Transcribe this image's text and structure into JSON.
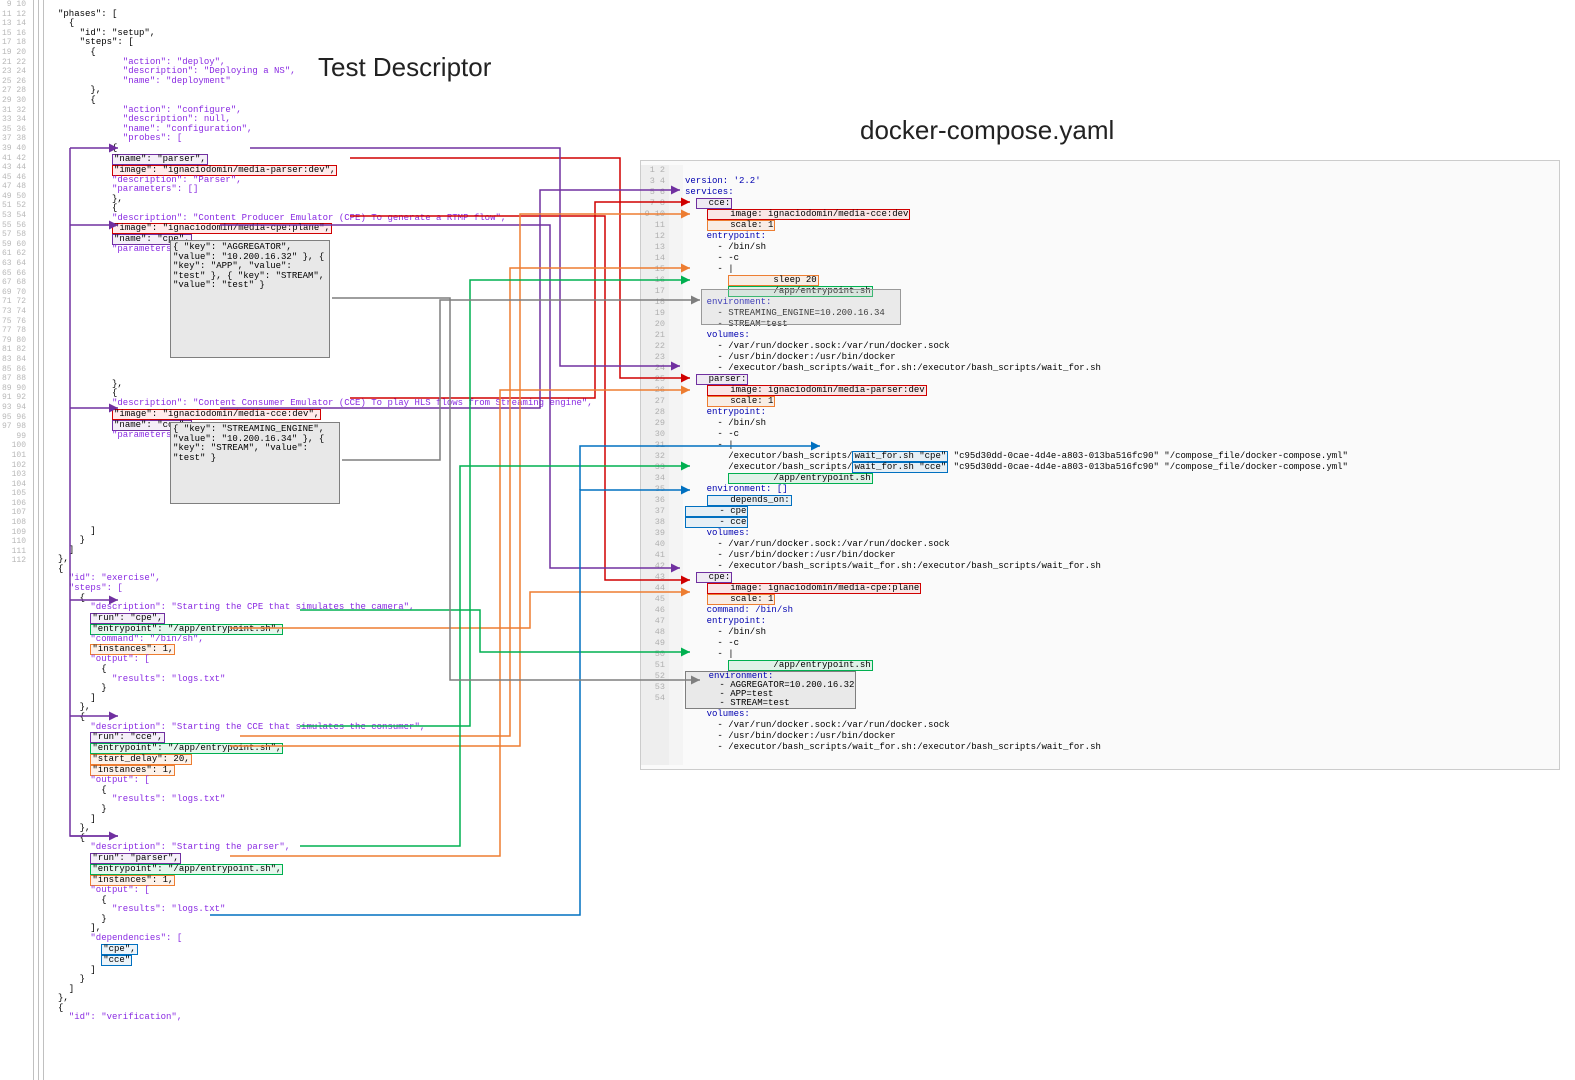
{
  "titles": {
    "left": "Test Descriptor",
    "right": "docker-compose.yaml"
  },
  "left_first_line": 9,
  "left_last_line": 112,
  "left_code": {
    "l9": "\"phases\": [",
    "l10": "{",
    "l11": "  \"id\": \"setup\",",
    "l12": "  \"steps\": [",
    "l13": "    {",
    "l14": "      \"action\": \"deploy\",",
    "l15": "      \"description\": \"Deploying a NS\",",
    "l16": "      \"name\": \"deployment\"",
    "l17": "    },",
    "l18": "    {",
    "l19": "      \"action\": \"configure\",",
    "l20": "      \"description\": null,",
    "l21": "      \"name\": \"configuration\",",
    "l22": "      \"probes\": [",
    "l23": "        {",
    "l24_name": "\"name\": \"parser\",",
    "l25_image": "\"image\": \"ignaciodomin/media-parser:dev\",",
    "l26": "          \"description\": \"Parser\",",
    "l27": "          \"parameters\": []",
    "l28": "        },",
    "l29": "        {",
    "l30": "          \"description\": \"Content Producer Emulator (CPE) To generate a RTMP flow\",",
    "l31_image": "\"image\": \"ignaciodomin/media-cpe:plane\",",
    "l32_name": "\"name\": \"cpe\",",
    "l33": "          \"parameters\": [",
    "p1_k1": "\"key\": \"AGGREGATOR\",",
    "p1_v1": "\"value\": \"10.200.16.32\"",
    "p1_k2": "\"key\": \"APP\",",
    "p1_v2": "\"value\": \"test\"",
    "p1_k3": "\"key\": \"STREAM\",",
    "p1_v3": "\"value\": \"test\"",
    "l47": "        },",
    "l48": "        {",
    "l49": "          \"description\": \"Content Consumer Emulator (CCE) To play HLS flows from Streaming engine\",",
    "l50_image": "\"image\": \"ignaciodomin/media-cce:dev\",",
    "l51_name": "\"name\": \"cce\",",
    "l52": "          \"parameters\": [",
    "p2_k1": "\"key\": \"STREAMING_ENGINE\",",
    "p2_v1": "\"value\": \"10.200.16.34\"",
    "p2_k2": "\"key\": \"STREAM\",",
    "p2_v2": "\"value\": \"test\"",
    "l62": "      ]",
    "l63": "    }",
    "l64": "  ]",
    "l65": "},",
    "l66": "{",
    "l67": "  \"id\": \"exercise\",",
    "l68": "  \"steps\": [",
    "l69": "    {",
    "l70": "      \"description\": \"Starting the CPE that simulates the camera\",",
    "l71_run": "\"run\": \"cpe\",",
    "l72_ep": "\"entrypoint\": \"/app/entrypoint.sh\",",
    "l73": "      \"command\": \"/bin/sh\",",
    "l74_inst": "\"instances\": 1,",
    "l75": "      \"output\": [",
    "l76": "        {",
    "l77": "          \"results\": \"logs.txt\"",
    "l78": "        }",
    "l79": "      ]",
    "l80": "    },",
    "l81": "    {",
    "l82": "      \"description\": \"Starting the CCE that simulates the consumer\",",
    "l83_run": "\"run\": \"cce\",",
    "l84_ep": "\"entrypoint\": \"/app/entrypoint.sh\",",
    "l85_delay": "\"start_delay\": 20,",
    "l86_inst": "\"instances\": 1,",
    "l87": "      \"output\": [",
    "l88": "        {",
    "l89": "          \"results\": \"logs.txt\"",
    "l90": "        }",
    "l91": "      ]",
    "l92": "    },",
    "l93": "    {",
    "l94": "      \"description\": \"Starting the parser\",",
    "l95_run": "\"run\": \"parser\",",
    "l96_ep": "\"entrypoint\": \"/app/entrypoint.sh\",",
    "l97_inst": "\"instances\": 1,",
    "l98": "      \"output\": [",
    "l99": "        {",
    "l100": "          \"results\": \"logs.txt\"",
    "l101": "        }",
    "l102": "      ],",
    "l103": "      \"dependencies\": [",
    "l104_dep1": "\"cpe\",",
    "l105_dep2": "\"cce\"",
    "l106": "      ]",
    "l107": "    }",
    "l108": "  ]",
    "l109": "},",
    "l110": "{",
    "l111": "  \"id\": \"verification\","
  },
  "right_code": {
    "r1": "version: '2.2'",
    "r2": "services:",
    "r3": "  cce:",
    "r4": "    image: ignaciodomin/media-cce:dev",
    "r5": "    scale: 1",
    "r6": "    entrypoint:",
    "r7": "      - /bin/sh",
    "r8": "      - -c",
    "r9": "      - |",
    "r10": "        sleep 20",
    "r11": "        /app/entrypoint.sh",
    "r12": "    environment:",
    "r13": "      - STREAMING_ENGINE=10.200.16.34",
    "r14": "      - STREAM=test",
    "r15": "    volumes:",
    "r16": "      - /var/run/docker.sock:/var/run/docker.sock",
    "r17": "      - /usr/bin/docker:/usr/bin/docker",
    "r18": "      - /executor/bash_scripts/wait_for.sh:/executor/bash_scripts/wait_for.sh",
    "r19": "  parser:",
    "r20": "    image: ignaciodomin/media-parser:dev",
    "r21": "    scale: 1",
    "r22": "    entrypoint:",
    "r23": "      - /bin/sh",
    "r24": "      - -c",
    "r25": "      - |",
    "r26_a": "        /executor/bash_scripts/",
    "r26_b": "wait_for.sh \"cpe\"",
    "r26_c": " \"c95d30dd-0cae-4d4e-a803-013ba516fc90\" \"/compose_file/docker-compose.yml\"",
    "r27_a": "        /executor/bash_scripts/",
    "r27_b": "wait_for.sh \"cce\"",
    "r27_c": " \"c95d30dd-0cae-4d4e-a803-013ba516fc90\" \"/compose_file/docker-compose.yml\"",
    "r28": "        /app/entrypoint.sh",
    "r29": "    environment: []",
    "r30": "    depends_on:",
    "r31": "      - cpe",
    "r32": "      - cce",
    "r33": "    volumes:",
    "r34": "      - /var/run/docker.sock:/var/run/docker.sock",
    "r35": "      - /usr/bin/docker:/usr/bin/docker",
    "r36": "      - /executor/bash_scripts/wait_for.sh:/executor/bash_scripts/wait_for.sh",
    "r37": "  cpe:",
    "r38": "    image: ignaciodomin/media-cpe:plane",
    "r39": "    scale: 1",
    "r40": "    command: /bin/sh",
    "r41": "    entrypoint:",
    "r42": "      - /bin/sh",
    "r43": "      - -c",
    "r44": "      - |",
    "r45": "        /app/entrypoint.sh",
    "r46": "    environment:",
    "r47": "      - AGGREGATOR=10.200.16.32",
    "r48": "      - APP=test",
    "r49": "      - STREAM=test",
    "r50": "    volumes:",
    "r51": "      - /var/run/docker.sock:/var/run/docker.sock",
    "r52": "      - /usr/bin/docker:/usr/bin/docker",
    "r53": "      - /executor/bash_scripts/wait_for.sh:/executor/bash_scripts/wait_for.sh",
    "r54": ""
  },
  "arrow_colors": {
    "red": "#d00000",
    "purple": "#7030a0",
    "orange": "#ed7d31",
    "green": "#00b050",
    "blue": "#0070c0",
    "gray": "#7f7f7f"
  }
}
